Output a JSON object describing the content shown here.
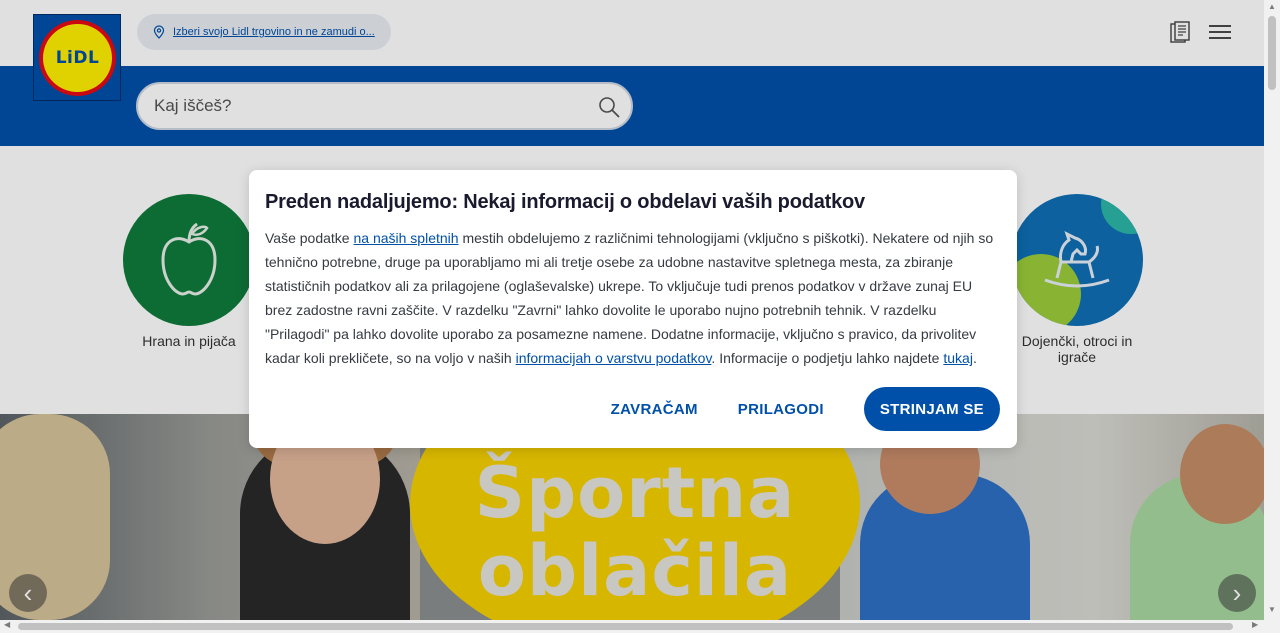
{
  "header": {
    "logo_text": "LiDL",
    "store_link": "Izberi svojo Lidl trgovino in ne zamudi o...",
    "brochure_icon": "brochure-icon",
    "menu_icon": "hamburger-menu-icon"
  },
  "search": {
    "placeholder": "Kaj iščeš?",
    "icon": "search-icon"
  },
  "categories": [
    {
      "label": "Hrana in pijača",
      "icon": "apple-icon",
      "color": "#0f7a3c"
    },
    {
      "label": "Dojenčki, otroci in igrače",
      "icon": "rocking-horse-icon",
      "color": "#0e6fb4"
    }
  ],
  "hero": {
    "line1": "Športna",
    "line2": "oblačila",
    "prev_label": "‹",
    "next_label": "›"
  },
  "dialog": {
    "title": "Preden nadaljujemo: Nekaj informacij o obdelavi vaših podatkov",
    "text_1": "Vaše podatke ",
    "link_1": "na naših spletnih",
    "text_2": " mestih obdelujemo z različnimi tehnologijami (vključno s piškotki). Nekatere od njih so tehnično potrebne, druge pa uporabljamo mi ali tretje osebe za udobne nastavitve spletnega mesta, za zbiranje statističnih podatkov ali za prilagojene (oglaševalske) ukrepe. To vključuje tudi prenos podatkov v države zunaj EU brez zadostne ravni zaščite. V razdelku \"Zavrni\" lahko dovolite le uporabo nujno potrebnih tehnik. V razdelku \"Prilagodi\" pa lahko dovolite uporabo za posamezne namene. Dodatne informacije, vključno s pravico, da privolitev kadar koli prekličete, so na voljo v naših ",
    "link_2": "informacijah o varstvu podatkov",
    "text_3": ". Informacije o podjetju lahko najdete ",
    "link_3": "tukaj",
    "text_4": ".",
    "reject_label": "ZAVRAČAM",
    "customize_label": "PRILAGODI",
    "accept_label": "STRINJAM SE"
  },
  "colors": {
    "brand_blue": "#0050aa",
    "brand_yellow": "#fff000",
    "brand_red": "#e60a14"
  }
}
